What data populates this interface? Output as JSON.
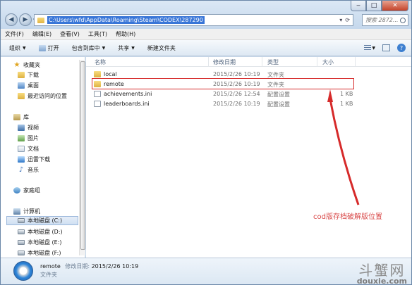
{
  "window": {
    "path": "C:\\Users\\wfd\\AppData\\Roaming\\Steam\\CODEX\\287290",
    "search_placeholder": "搜索 2872...",
    "buttons": {
      "minimize": "‒",
      "maximize": "□",
      "close": "✕"
    },
    "nav": {
      "back": "◀",
      "forward": "▶",
      "dropdown": "▾"
    }
  },
  "menu": [
    "文件(F)",
    "编辑(E)",
    "查看(V)",
    "工具(T)",
    "帮助(H)"
  ],
  "toolbar": {
    "organize": "组织",
    "open": "打开",
    "include": "包含到库中",
    "share": "共享",
    "new_folder": "新建文件夹",
    "help": "?"
  },
  "sidebar": {
    "favorites": "收藏夹",
    "downloads": "下载",
    "desktop": "桌面",
    "recent": "最近访问的位置",
    "libraries": "库",
    "videos": "视频",
    "pictures": "图片",
    "documents": "文档",
    "thunder": "迅雷下载",
    "music": "音乐",
    "homegroup": "家庭组",
    "computer": "计算机",
    "drives": [
      "本地磁盘 (C:)",
      "本地磁盘 (D:)",
      "本地磁盘 (E:)",
      "本地磁盘 (F:)"
    ]
  },
  "columns": {
    "name": "名称",
    "modified": "修改日期",
    "type": "类型",
    "size": "大小"
  },
  "files": [
    {
      "name": "local",
      "modified": "2015/2/26 10:19",
      "type": "文件夹",
      "size": "",
      "icon": "folder"
    },
    {
      "name": "remote",
      "modified": "2015/2/26 10:19",
      "type": "文件夹",
      "size": "",
      "icon": "folder"
    },
    {
      "name": "achievements.ini",
      "modified": "2015/2/26 12:54",
      "type": "配置设置",
      "size": "1 KB",
      "icon": "ini"
    },
    {
      "name": "leaderboards.ini",
      "modified": "2015/2/26 10:19",
      "type": "配置设置",
      "size": "1 KB",
      "icon": "ini"
    }
  ],
  "annotation": {
    "text": "cod版存档破解版位置",
    "color": "#d62a2a"
  },
  "details": {
    "name": "remote",
    "modified_label": "修改日期:",
    "modified": "2015/2/26 10:19",
    "type": "文件夹"
  },
  "watermark": {
    "zh": "斗蟹网",
    "en": "douxie.com"
  }
}
